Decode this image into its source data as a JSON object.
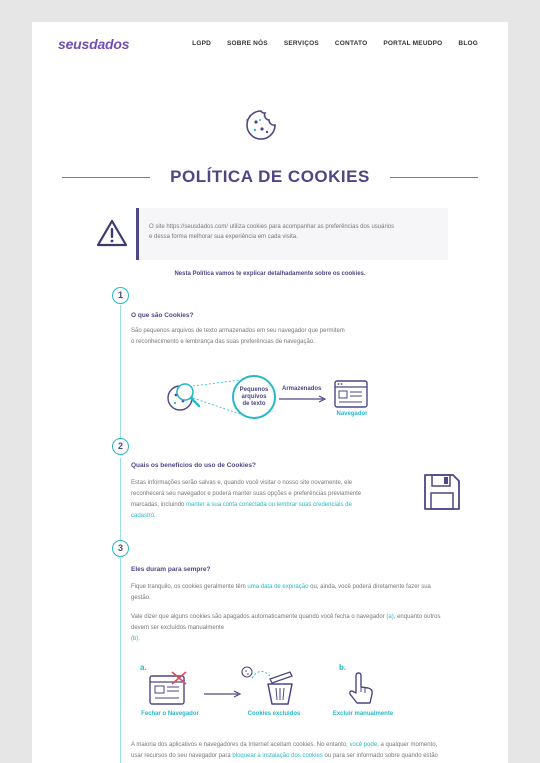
{
  "header": {
    "logo": "seusdados",
    "menu": [
      "LGPD",
      "SOBRE NÓS",
      "SERVIÇOS",
      "CONTATO",
      "PORTAL MEUDPO",
      "BLOG"
    ]
  },
  "page_title": "POLÍTICA DE COOKIES",
  "notice": {
    "line1": "O site https://seusdados.com/ utiliza cookies para acompanhar as preferências dos usuários",
    "line2": "e dessa forma melhorar sua experiência em cada visita."
  },
  "intro": "Nesta Política vamos te explicar detalhadamente sobre os cookies.",
  "sections": [
    {
      "number": "1",
      "title": "O que são Cookies?",
      "line1": "São pequenos arquivos de texto armazenados em seu navegador que permitem",
      "line2": "o reconhecimento e lembrança das suas preferências de navegação."
    },
    {
      "number": "2",
      "title": "Quais os benefícios do uso de Cookies?",
      "line1": "Estas informações serão salvas e, quando você visitar o nosso site novamente, ele",
      "line2": "reconhecerá seu navegador e poderá manter suas opções e preferências previamente",
      "line3_pre": "marcadas, incluindo ",
      "line3_link": "manter a sua conta conectada ou lembrar suas credenciais de",
      "line4_link": "cadastro."
    },
    {
      "number": "3",
      "title": "Eles duram para sempre?",
      "p1_pre": "Fique tranquilo, os cookies geralmente têm ",
      "p1_link": "uma data de expiração",
      "p1_post": " ou, ainda, você poderá diretamente fazer sua",
      "p1_line2": "gestão.",
      "p2_pre": "Vale dizer que alguns cookies são apagados automaticamente quando você fecha o navegador ",
      "p2_link": "(a)",
      "p2_post": ", enquanto outros",
      "p2_line2": "devem ser excluídos manualmente",
      "p2_link2": "(b)."
    }
  ],
  "diagram1": {
    "bubble": [
      "Pequenos",
      "arquivos",
      "de texto"
    ],
    "arrow_label": "Armazenados",
    "browser_label": "Navegador"
  },
  "diagram3": {
    "letter_a": "a.",
    "letter_b": "b.",
    "label_close": "Fechar o Navegador",
    "label_deleted": "Cookies excluídos",
    "label_manual": "Excluir manualmente"
  },
  "footer_text": {
    "line1_pre": "A maioria dos aplicativos e navegadores da Internet aceitam cookies. No entanto, ",
    "line1_link": "você pode",
    "line1_post": ", a qualquer momento,",
    "line2_pre": "usar recursos do seu navegador para ",
    "line2_link": "bloquear a instalação dos cookies",
    "line2_post": " ou para ser informado sobre quando estão"
  },
  "colors": {
    "accent": "#27b8c8",
    "primary": "#4d4785",
    "brand": "#6f4fb8"
  }
}
